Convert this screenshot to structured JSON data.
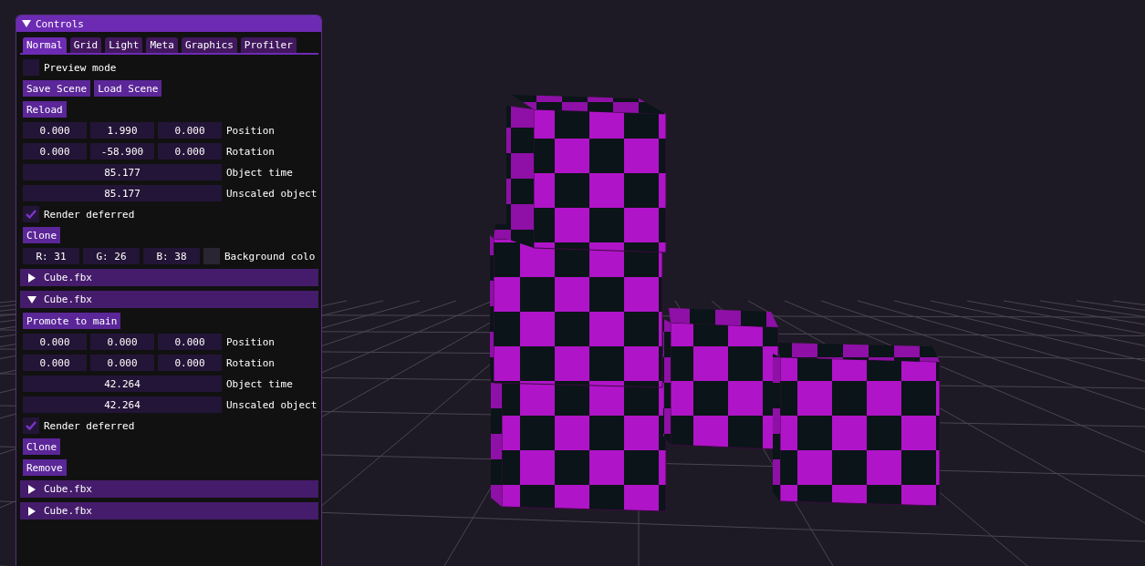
{
  "window": {
    "title": "Controls",
    "expanded": true
  },
  "tabs": [
    {
      "label": "Normal",
      "selected": true
    },
    {
      "label": "Grid",
      "selected": false
    },
    {
      "label": "Light",
      "selected": false
    },
    {
      "label": "Meta",
      "selected": false
    },
    {
      "label": "Graphics",
      "selected": false
    },
    {
      "label": "Profiler",
      "selected": false
    }
  ],
  "preview_mode": {
    "label": "Preview mode",
    "checked": false
  },
  "scene_buttons": [
    "Save Scene",
    "Load Scene"
  ],
  "reload_button": "Reload",
  "main_object": {
    "position": {
      "values": [
        "0.000",
        "1.990",
        "0.000"
      ],
      "label": "Position"
    },
    "rotation": {
      "values": [
        "0.000",
        "-58.900",
        "0.000"
      ],
      "label": "Rotation"
    },
    "object_time": {
      "value": "85.177",
      "label": "Object time"
    },
    "unscaled_time": {
      "value": "85.177",
      "label": "Unscaled object"
    },
    "render_deferred": {
      "label": "Render deferred",
      "checked": true
    },
    "buttons": [
      "Clone"
    ]
  },
  "background_color": {
    "channels": [
      "R: 31",
      "G: 26",
      "B: 38"
    ],
    "label": "Background colo"
  },
  "objects": [
    {
      "name": "Cube.fbx",
      "expanded": false
    },
    {
      "name": "Cube.fbx",
      "expanded": true,
      "promote_button": "Promote to main",
      "position": {
        "values": [
          "0.000",
          "0.000",
          "0.000"
        ],
        "label": "Position"
      },
      "rotation": {
        "values": [
          "0.000",
          "0.000",
          "0.000"
        ],
        "label": "Rotation"
      },
      "object_time": {
        "value": "42.264",
        "label": "Object time"
      },
      "unscaled_time": {
        "value": "42.264",
        "label": "Unscaled object"
      },
      "render_deferred": {
        "label": "Render deferred",
        "checked": true
      },
      "buttons": [
        "Clone",
        "Remove"
      ]
    },
    {
      "name": "Cube.fbx",
      "expanded": false
    },
    {
      "name": "Cube.fbx",
      "expanded": false
    }
  ]
}
